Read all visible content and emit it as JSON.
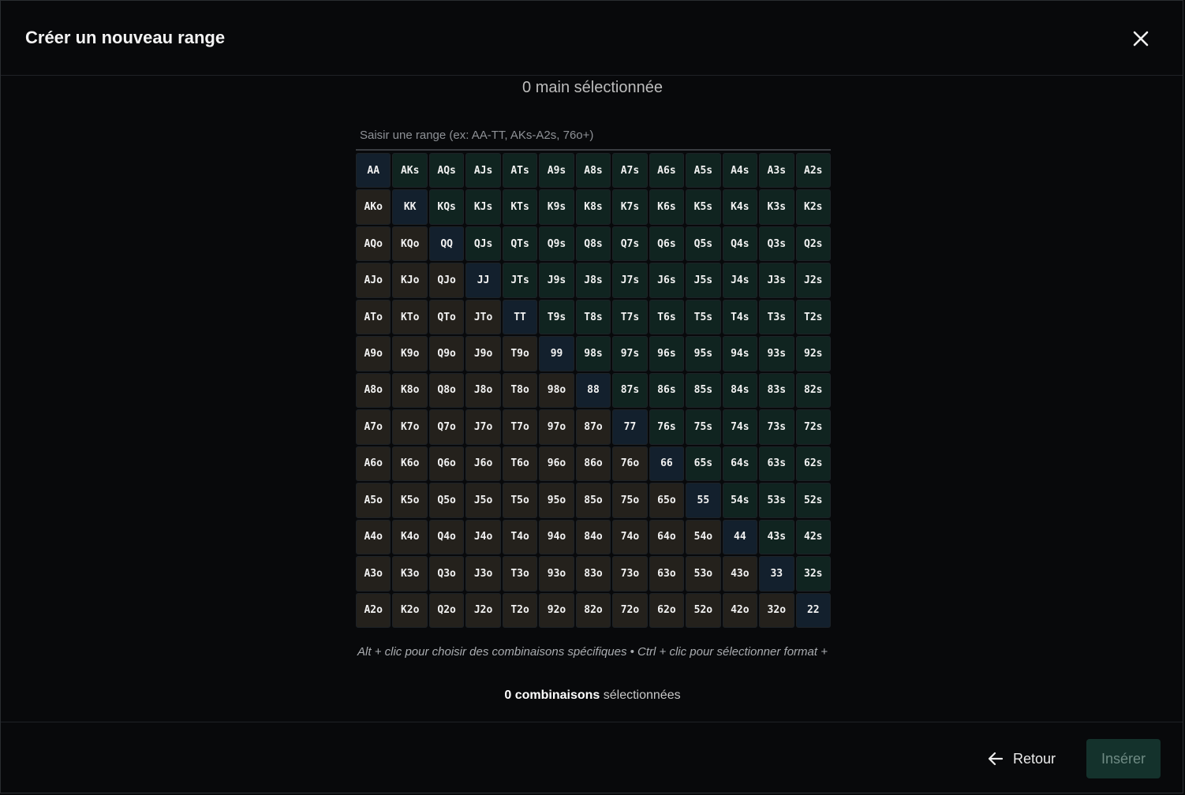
{
  "modal": {
    "title": "Créer un nouveau range",
    "selected_count": "0 main sélectionnée",
    "range_input": {
      "value": "",
      "placeholder": "Saisir une range (ex: AA-TT, AKs-A2s, 76o+)"
    },
    "hint": "Alt + clic pour choisir des combinaisons spécifiques • Ctrl + clic pour sélectionner format +",
    "combos": {
      "count": "0 combinaisons",
      "suffix": " sélectionnées"
    },
    "footer": {
      "back_label": "Retour",
      "insert_label": "Insérer"
    },
    "icons": {
      "close": "close-icon",
      "back": "arrow-left-icon"
    }
  },
  "grid": {
    "ranks": [
      "A",
      "K",
      "Q",
      "J",
      "T",
      "9",
      "8",
      "7",
      "6",
      "5",
      "4",
      "3",
      "2"
    ],
    "colors": {
      "suited": "#102420",
      "offsuit": "#24211c",
      "pair": "#13202d"
    }
  }
}
